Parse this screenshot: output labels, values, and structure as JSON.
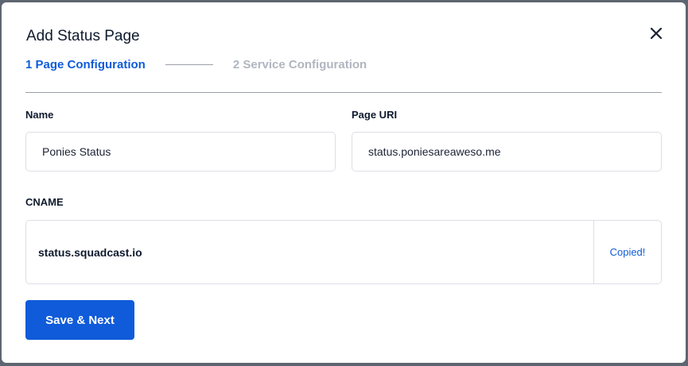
{
  "dialog": {
    "title": "Add Status Page",
    "close_icon": "close-icon"
  },
  "steps": [
    {
      "label": "1 Page Configuration",
      "active": true
    },
    {
      "label": "2 Service Configuration",
      "active": false
    }
  ],
  "form": {
    "name": {
      "label": "Name",
      "value": "Ponies Status"
    },
    "page_uri": {
      "label": "Page URI",
      "value": "status.poniesareaweso.me"
    },
    "cname": {
      "label": "CNAME",
      "value": "status.squadcast.io",
      "copy_label": "Copied!"
    }
  },
  "actions": {
    "save_label": "Save & Next"
  },
  "colors": {
    "accent": "#0f5bd9",
    "backdrop": "#5e6570"
  }
}
